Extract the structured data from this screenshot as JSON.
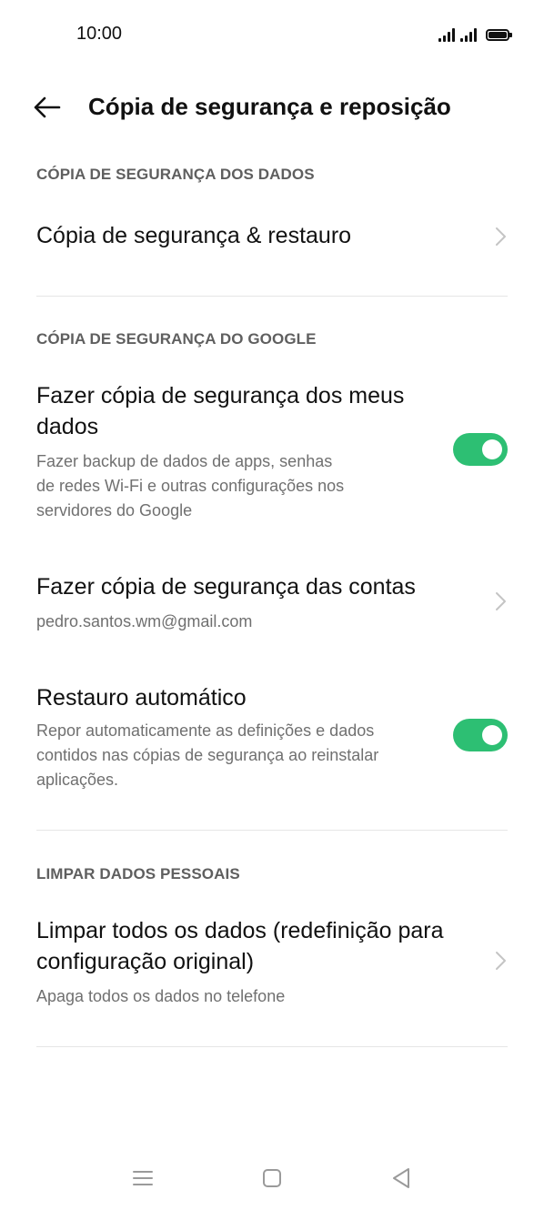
{
  "status_bar": {
    "time": "10:00",
    "icons": [
      "signal-icon",
      "signal-icon",
      "battery-icon"
    ]
  },
  "header": {
    "title": "Cópia de segurança e reposição",
    "back_icon": "back-arrow-icon"
  },
  "sections": {
    "data_backup": {
      "header": "CÓPIA DE SEGURANÇA DOS DADOS",
      "backup_restore": {
        "title": "Cópia de segurança & restauro"
      }
    },
    "google_backup": {
      "header": "CÓPIA DE SEGURANÇA DO GOOGLE",
      "backup_my_data": {
        "title_line1": "Fazer cópia de segurança dos meus",
        "title_line2": "dados",
        "sub_line1": "Fazer backup de dados de apps, senhas",
        "sub_line2": "de redes Wi-Fi e outras configurações nos",
        "sub_line3": "servidores do Google",
        "enabled": true
      },
      "backup_account": {
        "title": "Fazer cópia de segurança das contas",
        "account": "pedro.santos.wm@gmail.com"
      },
      "auto_restore": {
        "title": "Restauro automático",
        "sub_line1": "Repor automaticamente as definições e dados",
        "sub_line2": "contidos nas cópias de segurança ao reinstalar",
        "sub_line3": "aplicações.",
        "enabled": true
      }
    },
    "personal_data": {
      "header": "LIMPAR DADOS PESSOAIS",
      "factory_reset": {
        "title_line1": "Limpar todos os dados (redefinição para",
        "title_line2": "configuração original)",
        "sub": "Apaga todos os dados no telefone"
      }
    }
  },
  "colors": {
    "toggle_on": "#2dbf73",
    "section_header": "#5f5f5f",
    "subtext": "#707070",
    "divider": "#e6e6e6"
  },
  "nav_bar": {
    "icons": [
      "menu-icon",
      "home-icon",
      "back-icon"
    ]
  }
}
